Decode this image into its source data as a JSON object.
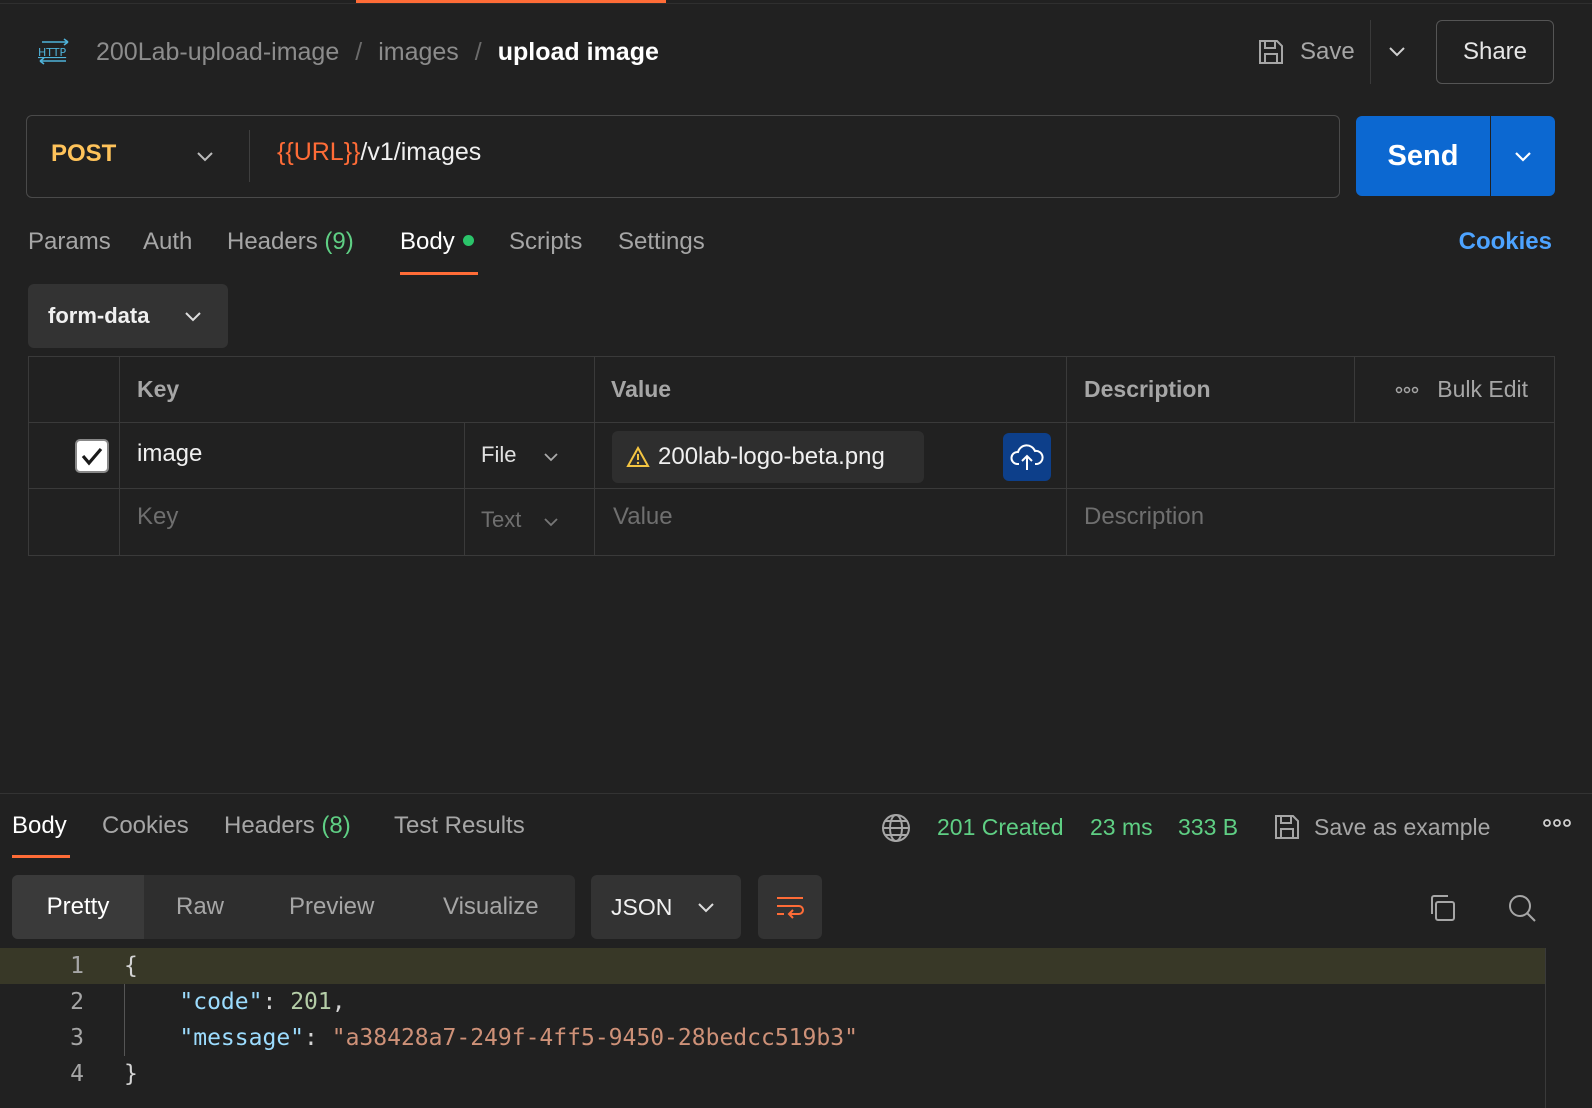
{
  "header": {
    "breadcrumbs": [
      "200Lab-upload-image",
      "images",
      "upload image"
    ],
    "separator": "/",
    "save_label": "Save",
    "share_label": "Share"
  },
  "request": {
    "method": "POST",
    "url_variable": "{{URL}}",
    "url_path": "/v1/images",
    "send_label": "Send"
  },
  "request_tabs": {
    "params": "Params",
    "auth": "Auth",
    "headers": "Headers",
    "headers_count": "(9)",
    "body": "Body",
    "scripts": "Scripts",
    "settings": "Settings",
    "cookies": "Cookies"
  },
  "body_type": "form-data",
  "form_table": {
    "headers": {
      "key": "Key",
      "value": "Value",
      "description": "Description",
      "bulk_edit": "Bulk Edit"
    },
    "rows": [
      {
        "checked": true,
        "key": "image",
        "type": "File",
        "value": "200lab-logo-beta.png",
        "description": ""
      }
    ],
    "placeholder": {
      "key": "Key",
      "type": "Text",
      "value": "Value",
      "description": "Description"
    }
  },
  "response_tabs": {
    "body": "Body",
    "cookies": "Cookies",
    "headers": "Headers",
    "headers_count": "(8)",
    "test_results": "Test Results"
  },
  "response_meta": {
    "status": "201 Created",
    "time": "23 ms",
    "size": "333 B",
    "save_example": "Save as example"
  },
  "view_modes": [
    "Pretty",
    "Raw",
    "Preview",
    "Visualize"
  ],
  "format": "JSON",
  "code": {
    "line_numbers": [
      "1",
      "2",
      "3",
      "4"
    ],
    "open": "{",
    "close": "}",
    "code_key": "\"code\"",
    "code_value": "201",
    "message_key": "\"message\"",
    "message_value": "\"a38428a7-249f-4ff5-9450-28bedcc519b3\""
  },
  "colors": {
    "accent": "#ff6c37",
    "send": "#0c68d1",
    "success": "#5fcf84",
    "link": "#4da3ff"
  },
  "icons": [
    "http-icon",
    "save-icon",
    "chevron-down-icon",
    "warning-icon",
    "cloud-upload-icon",
    "more-icon",
    "globe-icon",
    "wrap-lines-icon",
    "copy-icon",
    "search-icon",
    "checkbox-checked-icon"
  ]
}
